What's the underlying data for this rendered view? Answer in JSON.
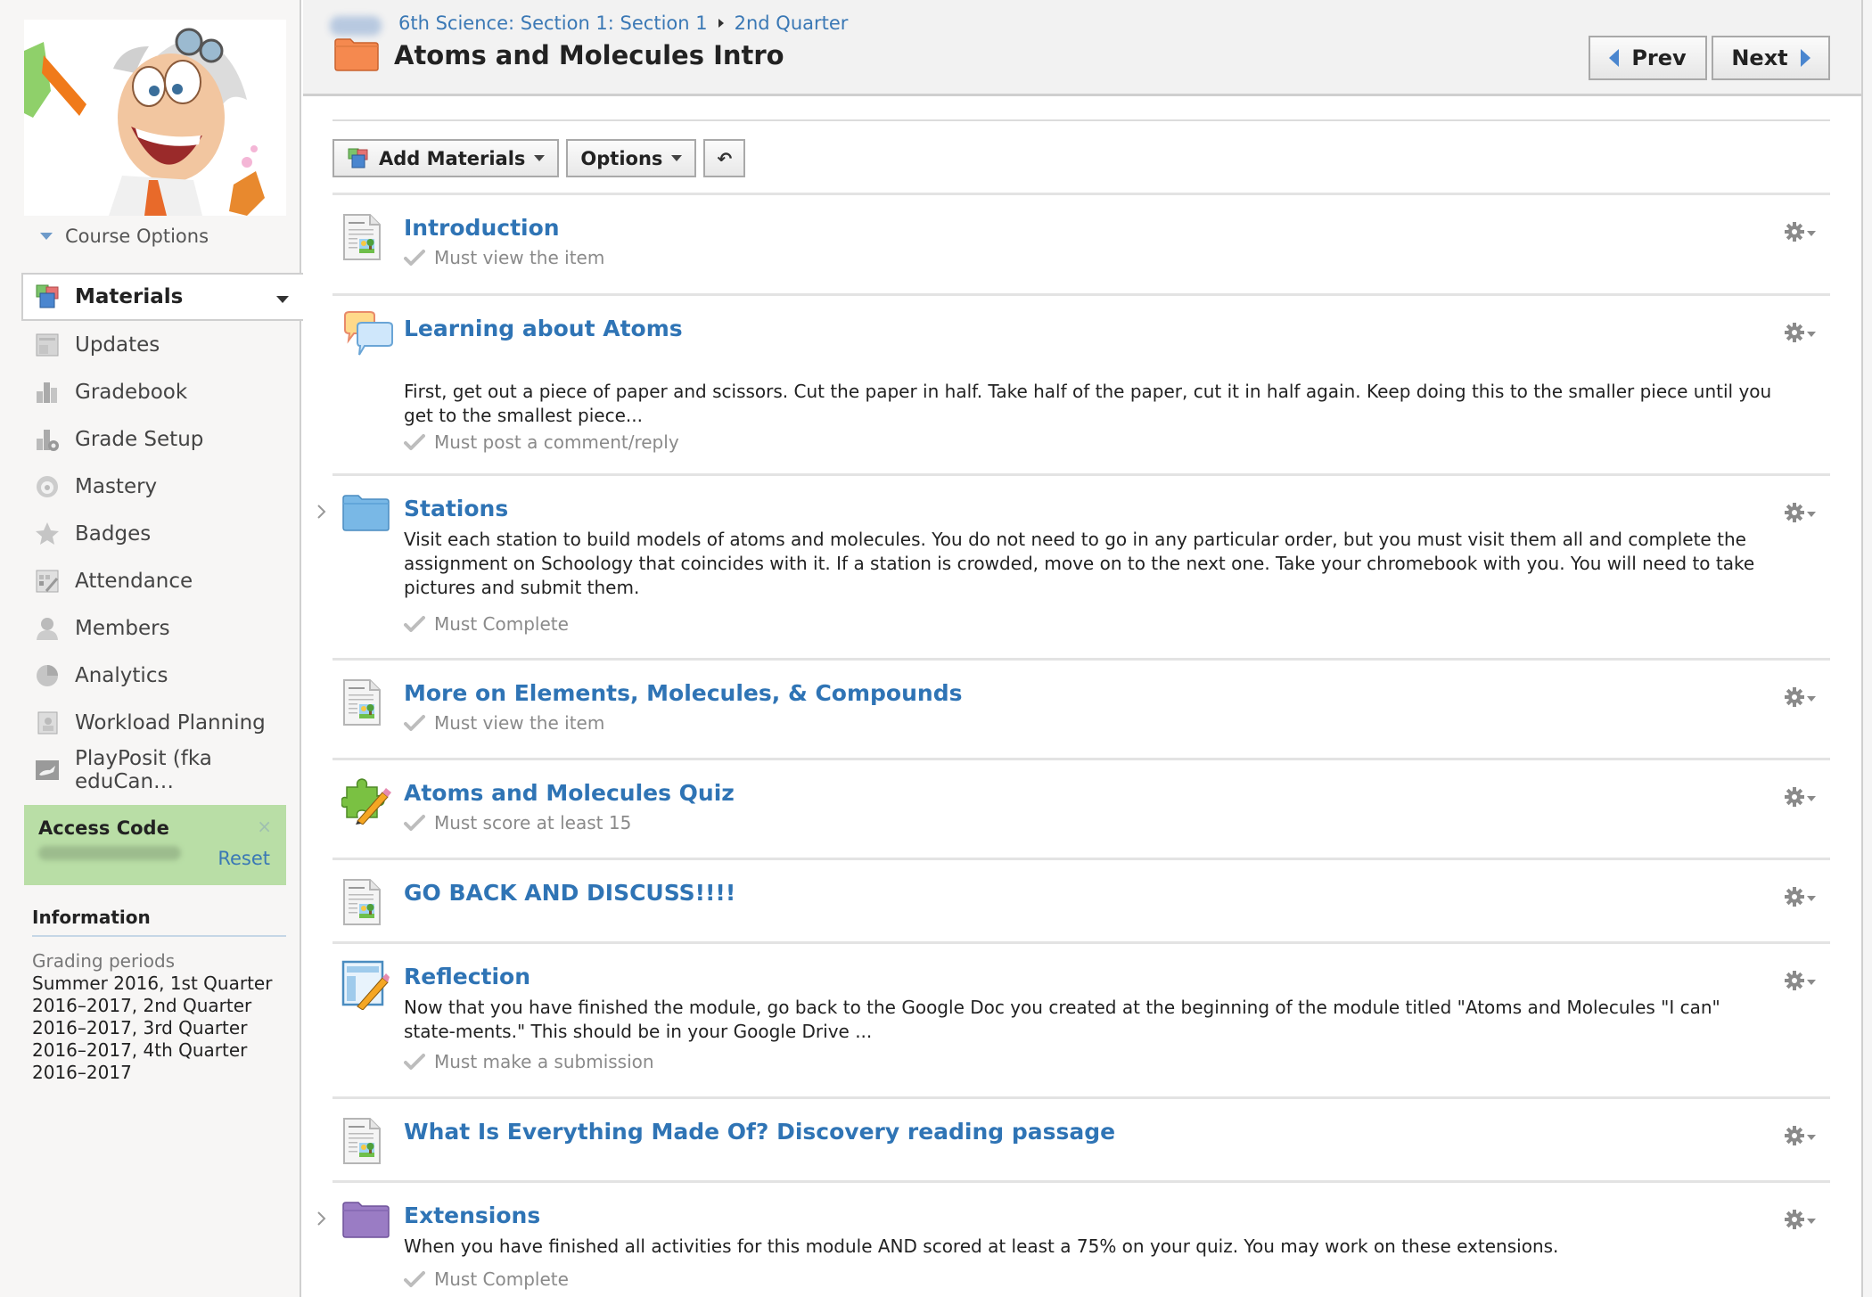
{
  "sidebar": {
    "course_options": "Course Options",
    "nav": [
      {
        "label": "Materials",
        "icon": "materials-icon",
        "active": true
      },
      {
        "label": "Updates",
        "icon": "updates-icon"
      },
      {
        "label": "Gradebook",
        "icon": "gradebook-icon"
      },
      {
        "label": "Grade Setup",
        "icon": "grade-setup-icon"
      },
      {
        "label": "Mastery",
        "icon": "mastery-icon"
      },
      {
        "label": "Badges",
        "icon": "badge-icon"
      },
      {
        "label": "Attendance",
        "icon": "attendance-icon"
      },
      {
        "label": "Members",
        "icon": "members-icon"
      },
      {
        "label": "Analytics",
        "icon": "analytics-icon"
      },
      {
        "label": "Workload Planning",
        "icon": "workload-planning-icon"
      },
      {
        "label": "PlayPosit (fka eduCan…",
        "icon": "playposit-icon"
      }
    ],
    "access_code": {
      "title": "Access Code",
      "close": "×",
      "reset": "Reset"
    },
    "information": {
      "title": "Information",
      "grading_label": "Grading periods",
      "periods": [
        "Summer 2016, 1st Quarter",
        "2016–2017, 2nd Quarter",
        "2016–2017, 3rd Quarter",
        "2016–2017, 4th Quarter",
        "2016–2017"
      ]
    }
  },
  "header": {
    "breadcrumb": [
      "6th Science: Section 1: Section 1",
      "2nd Quarter"
    ],
    "title": "Atoms and Molecules Intro",
    "folder_color": "#f5894f",
    "prev": "Prev",
    "next": "Next"
  },
  "toolbar": {
    "add_materials": "Add Materials",
    "options": "Options",
    "undo": "↶"
  },
  "colors": {
    "link": "#2f74b5",
    "access_bg": "#b9dea6",
    "stations_folder": "#79b8e6",
    "extensions_folder": "#9a7cc4"
  },
  "materials": [
    {
      "type": "page",
      "title": "Introduction",
      "desc": "",
      "req": "Must view the item"
    },
    {
      "type": "discussion",
      "title": "Learning about Atoms",
      "desc": "First, get out a piece of paper and scissors. Cut the paper in half. Take half of the paper, cut it in half again. Keep doing this to the smaller piece until you get to the smallest piece...",
      "req": "Must post a comment/reply"
    },
    {
      "type": "folder-blue",
      "title": "Stations",
      "desc": "Visit each station to build models of atoms and molecules.  You do not need to go in any particular order, but you must visit them all and complete the assignment on Schoology that coincides with it.  If a station is crowded, move on to the next one.  Take your chromebook with you.  You will need to take pictures and submit them.",
      "req": "Must Complete"
    },
    {
      "type": "page",
      "title": "More on Elements, Molecules, & Compounds",
      "desc": "",
      "req": "Must view the item"
    },
    {
      "type": "quiz",
      "title": "Atoms and Molecules Quiz",
      "desc": "",
      "req": "Must score at least 15"
    },
    {
      "type": "page",
      "title": "GO BACK AND DISCUSS!!!!",
      "desc": "",
      "req": ""
    },
    {
      "type": "assignment",
      "title": "Reflection",
      "desc": "Now that you have finished the module, go back to the Google Doc you created at the beginning of the module titled \"Atoms and Molecules \"I can\" state-ments.\" This should be in your Google Drive ...",
      "req": "Must make a submission"
    },
    {
      "type": "page",
      "title": "What Is Everything Made Of? Discovery reading passage",
      "desc": "",
      "req": ""
    },
    {
      "type": "folder-purple",
      "title": "Extensions",
      "desc": "When you have finished all activities for this module AND scored at least a 75% on your quiz.  You may work on these extensions.",
      "req": "Must Complete"
    }
  ]
}
